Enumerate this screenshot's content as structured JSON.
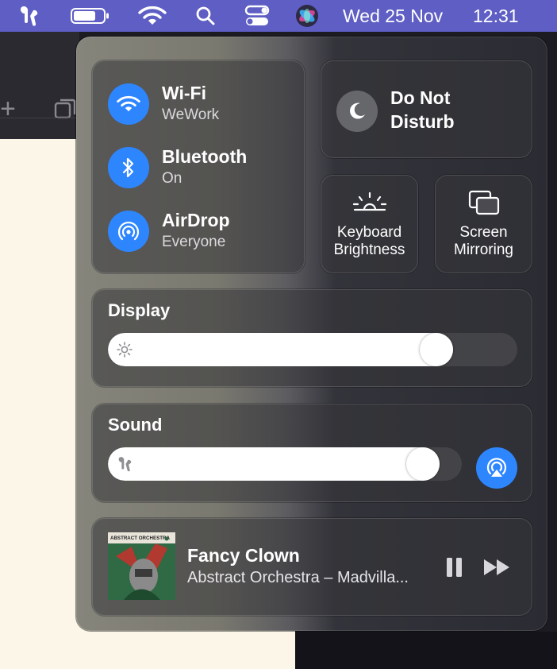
{
  "menubar": {
    "date": "Wed 25 Nov",
    "time": "12:31",
    "icons": [
      "airpods-icon",
      "battery-icon",
      "wifi-icon",
      "spotlight-search-icon",
      "control-center-icon",
      "siri-icon"
    ]
  },
  "control_center": {
    "wifi": {
      "label": "Wi-Fi",
      "status": "WeWork"
    },
    "bluetooth": {
      "label": "Bluetooth",
      "status": "On"
    },
    "airdrop": {
      "label": "AirDrop",
      "status": "Everyone"
    },
    "do_not_disturb": {
      "line1": "Do Not",
      "line2": "Disturb"
    },
    "keyboard_brightness": {
      "line1": "Keyboard",
      "line2": "Brightness"
    },
    "screen_mirroring": {
      "line1": "Screen",
      "line2": "Mirroring"
    },
    "display": {
      "label": "Display",
      "level": 0.83
    },
    "sound": {
      "label": "Sound",
      "level": 0.93
    },
    "now_playing": {
      "title": "Fancy Clown",
      "artist": "Abstract Orchestra – Madvilla...",
      "album_art_text": "ABSTRACT ORCHESTRA"
    }
  },
  "colors": {
    "menubar": "#5e5ec4",
    "accent_blue": "#2e86ff",
    "doc_background": "#fbf6e8"
  }
}
